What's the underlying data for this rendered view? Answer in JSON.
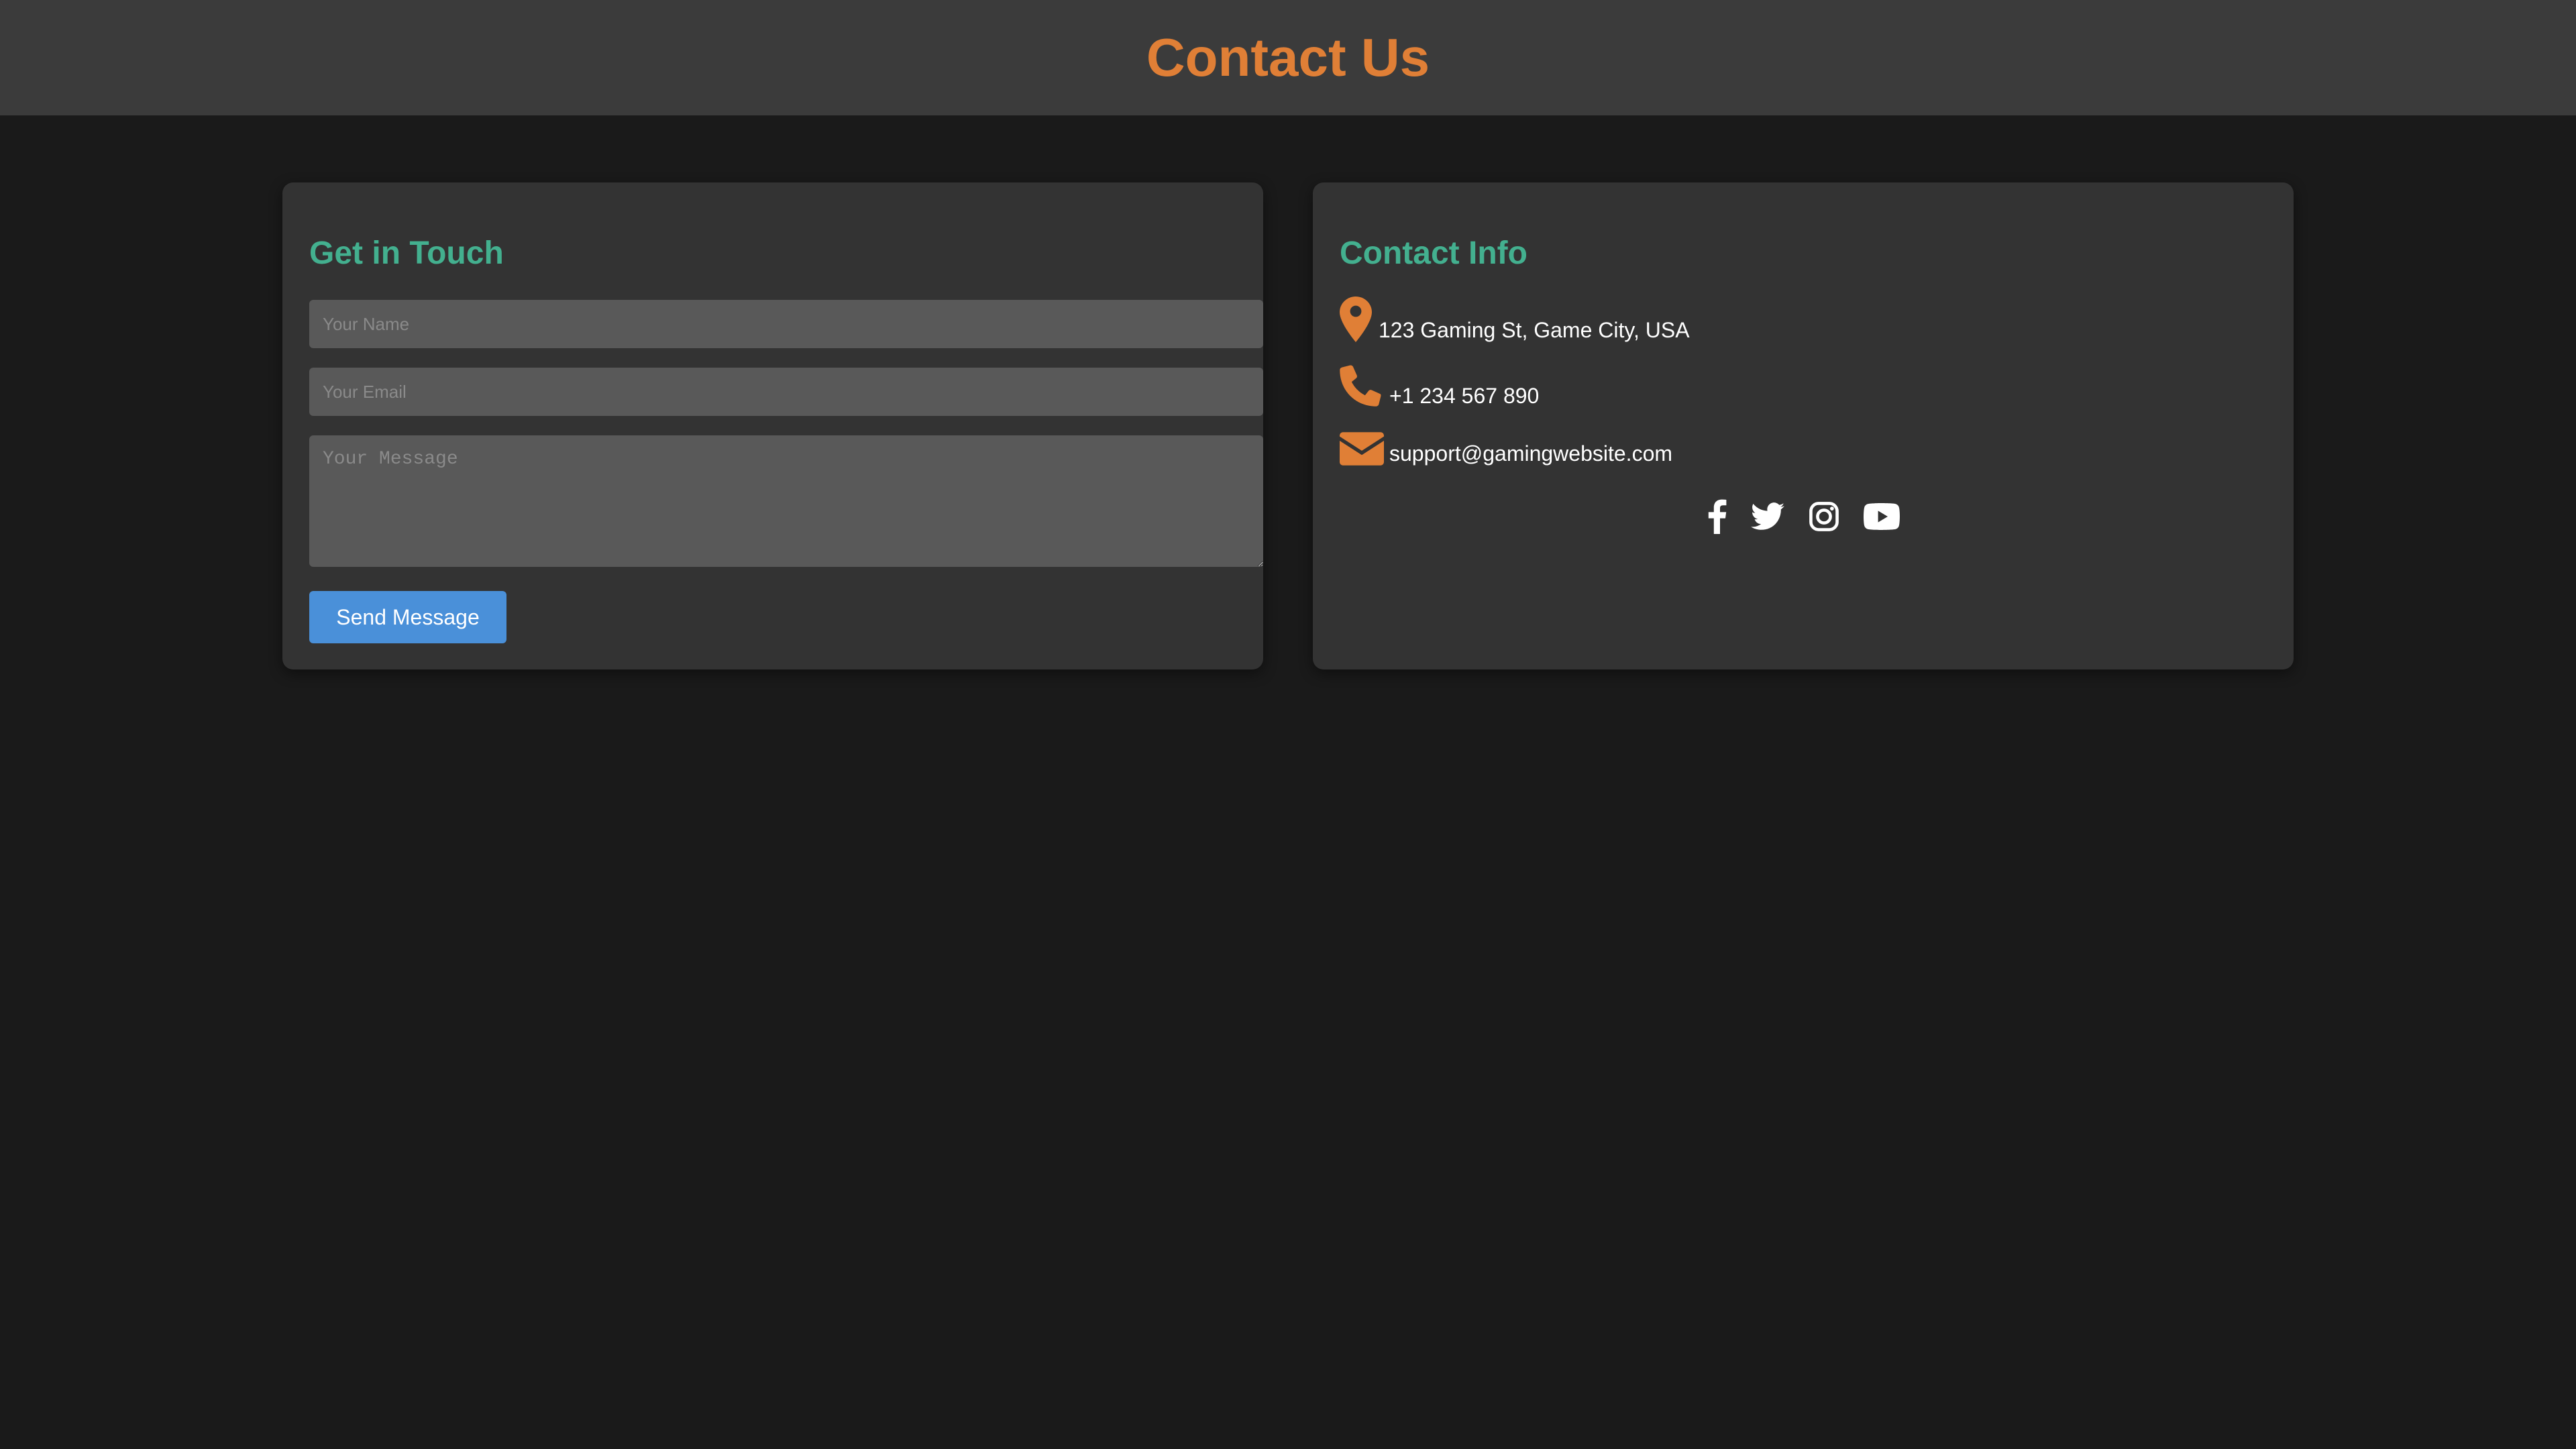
{
  "header": {
    "title": "Contact Us"
  },
  "form": {
    "title": "Get in Touch",
    "name_placeholder": "Your Name",
    "email_placeholder": "Your Email",
    "message_placeholder": "Your Message",
    "submit_label": "Send Message"
  },
  "contact_info": {
    "title": "Contact Info",
    "address": "123 Gaming St, Game City, USA",
    "phone": "+1 234 567 890",
    "email": "support@gamingwebsite.com",
    "icons": [
      "map-pin-icon",
      "phone-icon",
      "envelope-icon"
    ]
  },
  "social": {
    "links": [
      "facebook-icon",
      "twitter-icon",
      "instagram-icon",
      "youtube-icon"
    ]
  },
  "colors": {
    "accent_orange": "#e07f36",
    "heading_green": "#43b08f",
    "button_blue": "#4a90d9",
    "page_background": "#1a1a1a",
    "card_background": "#333333",
    "header_background": "#3b3b3b"
  }
}
